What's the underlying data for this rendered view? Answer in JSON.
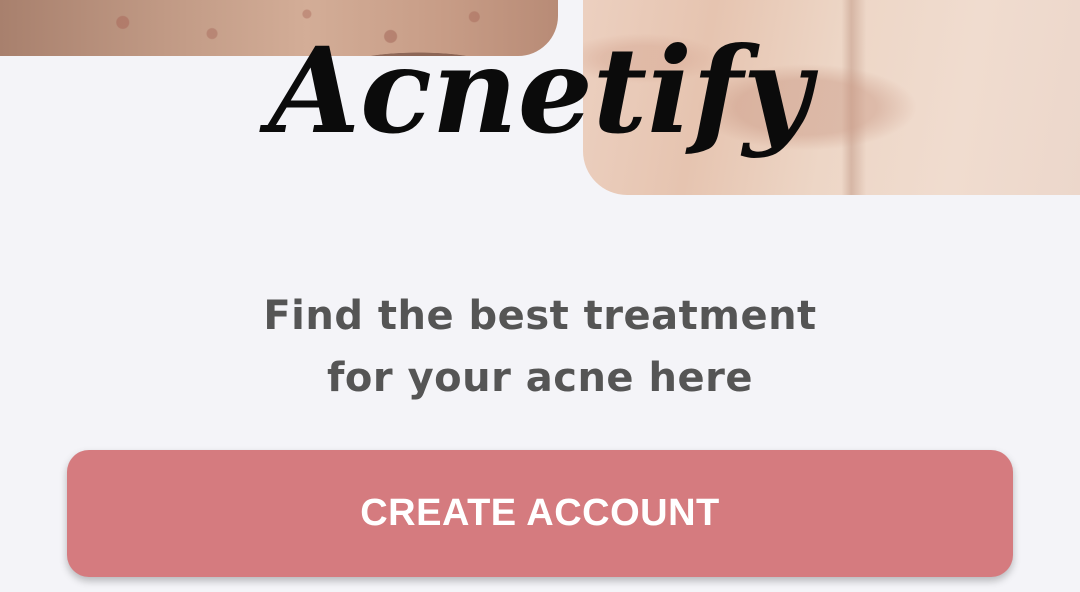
{
  "hero": {
    "logo_text": "Acnetify",
    "logo_color": "#0b0b0b"
  },
  "tagline": {
    "line1": "Find the best treatment",
    "line2": "for your acne here"
  },
  "actions": {
    "create_account_label": "CREATE ACCOUNT",
    "create_account_color": "#d57b7f"
  },
  "colors": {
    "background": "#f4f4f8",
    "tagline_text": "#555555",
    "button_text": "#ffffff"
  }
}
